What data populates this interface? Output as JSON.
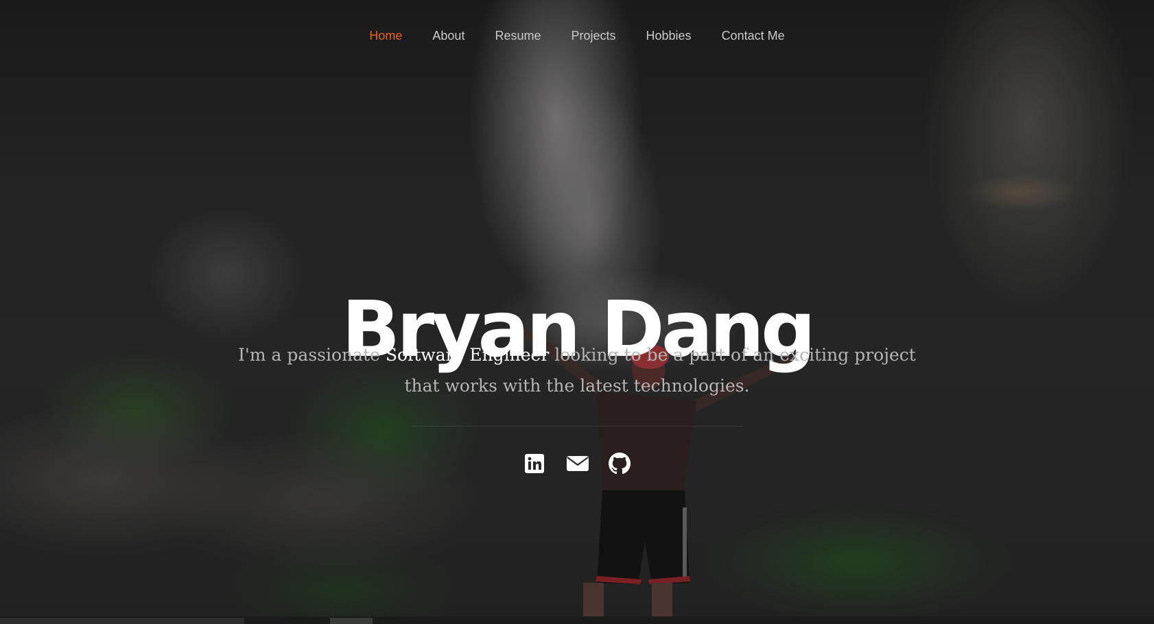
{
  "nav": {
    "items": [
      {
        "label": "Home",
        "active": true
      },
      {
        "label": "About",
        "active": false
      },
      {
        "label": "Resume",
        "active": false
      },
      {
        "label": "Projects",
        "active": false
      },
      {
        "label": "Hobbies",
        "active": false
      },
      {
        "label": "Contact Me",
        "active": false
      }
    ],
    "active_color": "#e5651d"
  },
  "hero": {
    "name": "Bryan Dang",
    "tagline_before": "I'm a passionate ",
    "tagline_highlight": "Software Engineer",
    "tagline_after": " looking to be a part of an exciting project that works with the latest technologies."
  },
  "social": [
    {
      "icon": "linkedin-icon"
    },
    {
      "icon": "envelope-icon"
    },
    {
      "icon": "github-icon"
    }
  ]
}
